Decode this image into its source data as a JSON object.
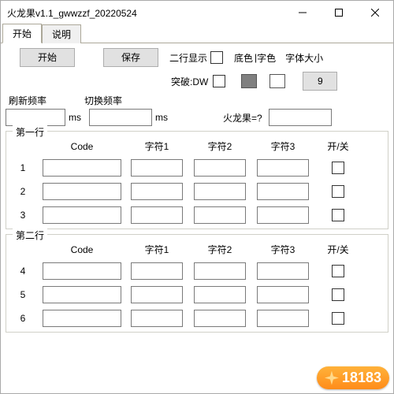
{
  "window": {
    "title": "火龙果v1.1_gwwzzf_20220524"
  },
  "tabs": [
    {
      "label": "开始",
      "active": true
    },
    {
      "label": "说明",
      "active": false
    }
  ],
  "toolbar": {
    "start_btn": "开始",
    "save_btn": "保存",
    "two_line_display": "二行显示",
    "bg_color_label": "底色",
    "pipe": "|",
    "fg_color_label": "字色",
    "font_size_label": "字体大小",
    "breakthrough_label": "突破:DW",
    "font_size_value": "9",
    "bg_swatch_hex": "#808080",
    "fg_swatch_hex": "#ffffff"
  },
  "freq": {
    "refresh_label": "刷新频率",
    "switch_label": "切换频率",
    "ms": "ms",
    "dragonfruit_q": "火龙果=?",
    "refresh_value": "",
    "switch_value": "",
    "dragonfruit_value": ""
  },
  "group1": {
    "legend": "第一行",
    "headers": {
      "code": "Code",
      "c1": "字符1",
      "c2": "字符2",
      "c3": "字符3",
      "onoff": "开/关"
    },
    "rows": [
      {
        "n": "1",
        "code": "",
        "c1": "",
        "c2": "",
        "c3": "",
        "on": false
      },
      {
        "n": "2",
        "code": "",
        "c1": "",
        "c2": "",
        "c3": "",
        "on": false
      },
      {
        "n": "3",
        "code": "",
        "c1": "",
        "c2": "",
        "c3": "",
        "on": false
      }
    ]
  },
  "group2": {
    "legend": "第二行",
    "headers": {
      "code": "Code",
      "c1": "字符1",
      "c2": "字符2",
      "c3": "字符3",
      "onoff": "开/关"
    },
    "rows": [
      {
        "n": "4",
        "code": "",
        "c1": "",
        "c2": "",
        "c3": "",
        "on": false
      },
      {
        "n": "5",
        "code": "",
        "c1": "",
        "c2": "",
        "c3": "",
        "on": false
      },
      {
        "n": "6",
        "code": "",
        "c1": "",
        "c2": "",
        "c3": "",
        "on": false
      }
    ]
  },
  "watermark": {
    "text": "18183"
  }
}
